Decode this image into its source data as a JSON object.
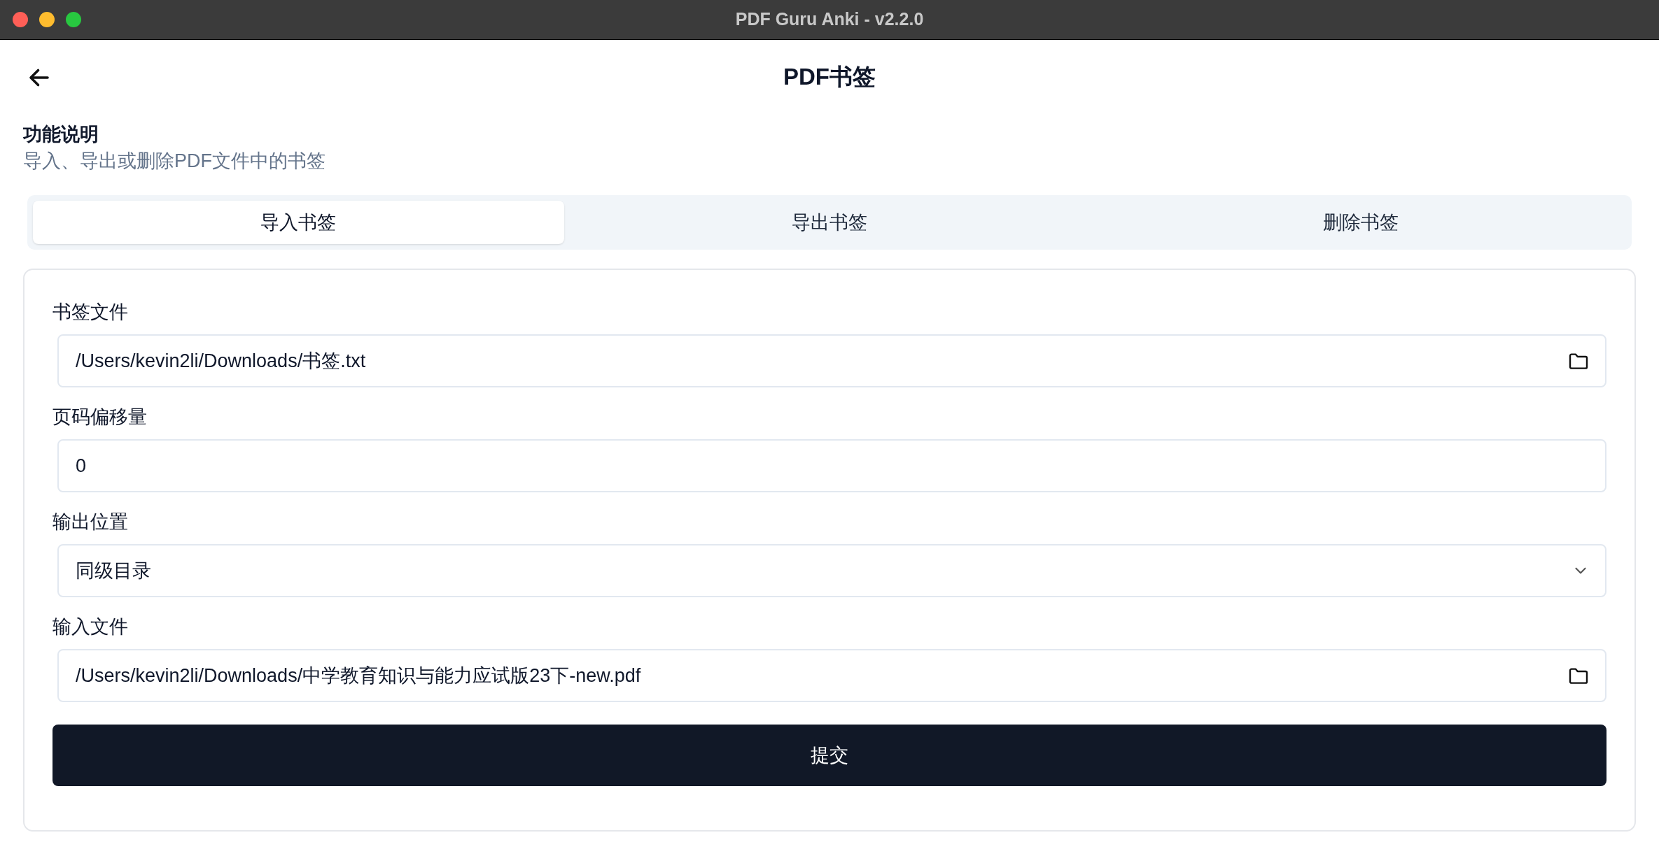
{
  "window": {
    "title": "PDF Guru Anki - v2.2.0"
  },
  "page": {
    "title": "PDF书签"
  },
  "description": {
    "heading": "功能说明",
    "text": "导入、导出或删除PDF文件中的书签"
  },
  "tabs": [
    {
      "label": "导入书签",
      "selected": true
    },
    {
      "label": "导出书签",
      "selected": false
    },
    {
      "label": "删除书签",
      "selected": false
    }
  ],
  "form": {
    "fields": [
      {
        "kind": "file",
        "label": "书签文件",
        "value": "/Users/kevin2li/Downloads/书签.txt"
      },
      {
        "kind": "text",
        "label": "页码偏移量",
        "value": "0"
      },
      {
        "kind": "select",
        "label": "输出位置",
        "value": "同级目录"
      },
      {
        "kind": "file",
        "label": "输入文件",
        "value": "/Users/kevin2li/Downloads/中学教育知识与能力应试版23下-new.pdf"
      }
    ],
    "submit": "提交"
  }
}
